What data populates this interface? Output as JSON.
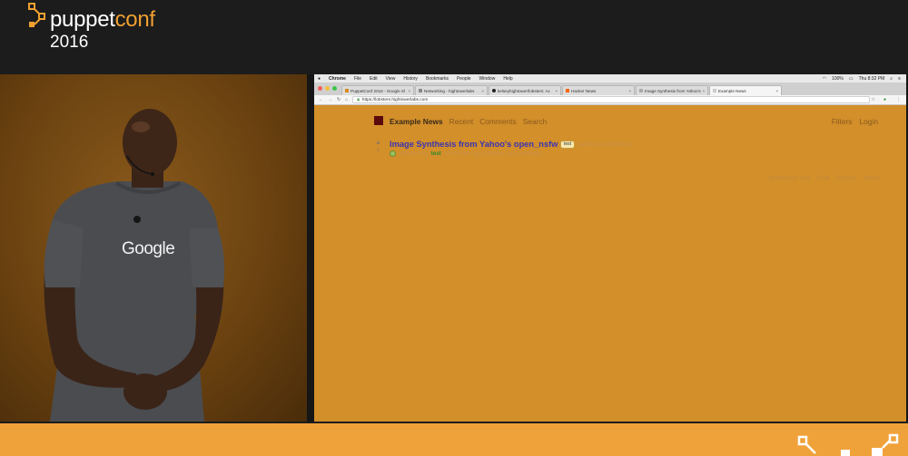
{
  "conference": {
    "name_part1": "puppet",
    "name_part2": "conf",
    "year": "2016"
  },
  "speaker": {
    "shirt_text": "Google"
  },
  "mac_menu": {
    "items": [
      "Chrome",
      "File",
      "Edit",
      "View",
      "History",
      "Bookmarks",
      "People",
      "Window",
      "Help"
    ],
    "status": {
      "battery": "100%",
      "clock": "Thu 8:32 PM"
    }
  },
  "browser": {
    "tabs": [
      {
        "label": "PuppetConf 2016 - Google Sl",
        "active": false
      },
      {
        "label": "Networking - hightowerlabs",
        "active": false
      },
      {
        "label": "kelseyhightower/lobsters: Ac",
        "active": false
      },
      {
        "label": "Hacker News",
        "active": false
      },
      {
        "label": "Image Synthesis from Yahoo's",
        "active": false
      },
      {
        "label": "Example News",
        "active": true
      }
    ],
    "url": "https://lobsters.hightowerlabs.com"
  },
  "site": {
    "brand": "Example News",
    "nav_links": [
      "Recent",
      "Comments",
      "Search"
    ],
    "nav_right": [
      "Filters",
      "Login"
    ],
    "story": {
      "title": "Image Synthesis from Yahoo's open_nsfw",
      "tag": "test",
      "domain": "yahoo.com.github.io",
      "byline_prefix": "authored by",
      "user": "test",
      "byline_rest": "14 minutes ago | hidden | no comments",
      "rank": "1"
    },
    "footer_links": [
      "Moderation Log",
      "Chat",
      "Privacy",
      "About"
    ]
  },
  "colors": {
    "page_bg": "#d28f2a",
    "brand_orange": "#f0a23a",
    "link_blue": "#3c34b0",
    "header_bg": "#1c1c1c"
  }
}
